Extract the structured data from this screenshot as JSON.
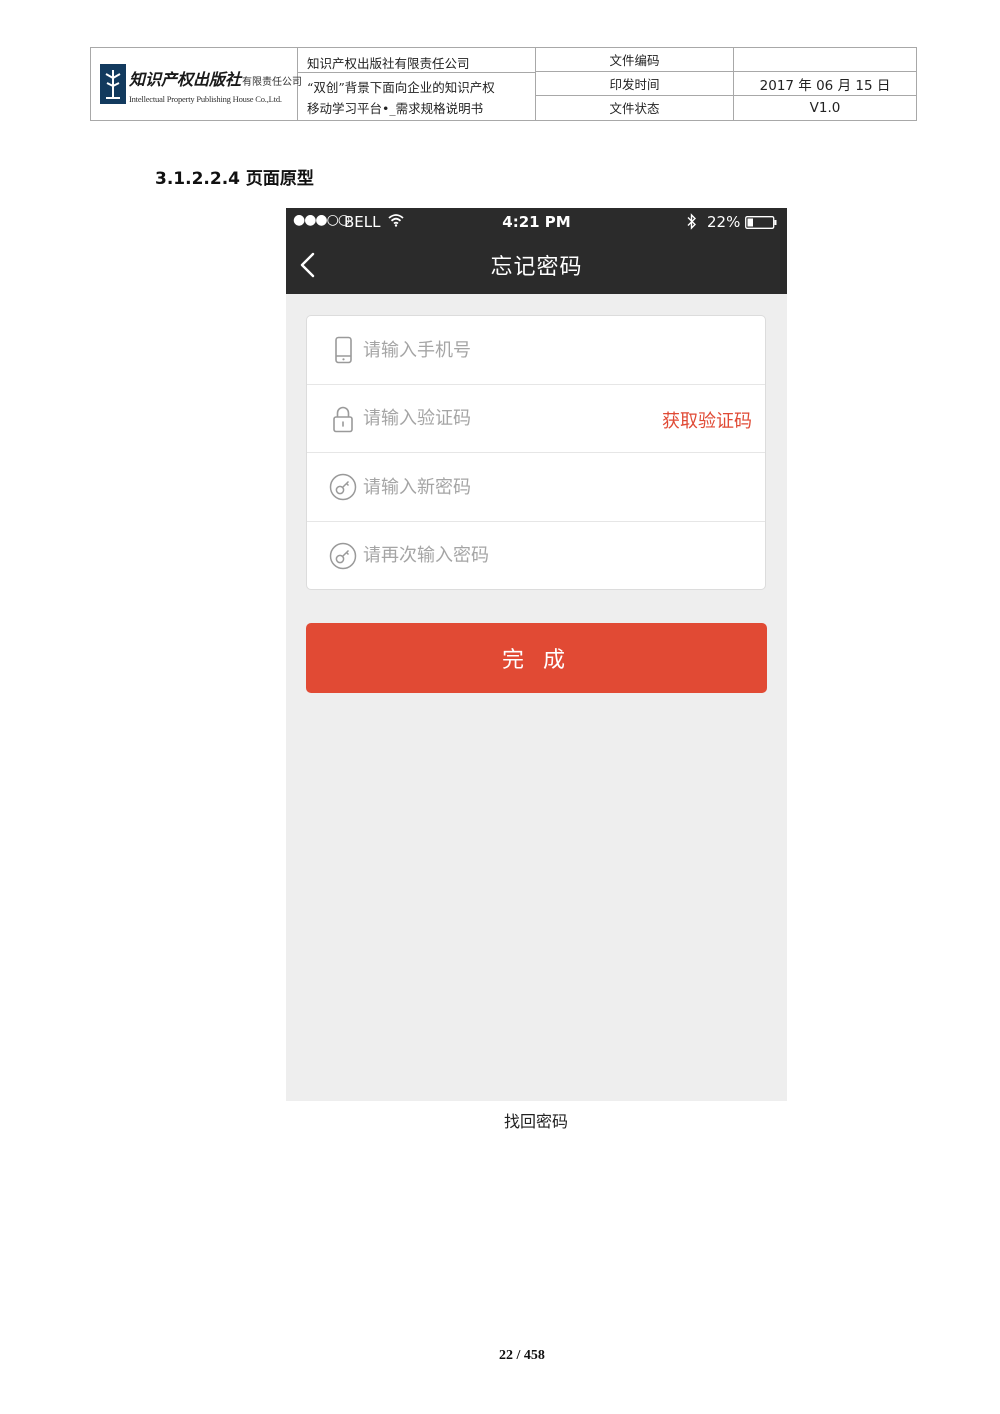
{
  "header": {
    "logo_name": "知识产权出版社",
    "logo_suffix": "有限责任公司",
    "logo_english": "Intellectual Property Publishing House Co.,Ltd.",
    "company": "知识产权出版社有限责任公司",
    "doc_title_line1": "“双创”背景下面向企业的知识产权",
    "doc_title_line2": "移动学习平台•_需求规格说明书",
    "labels": [
      "文件编码",
      "印发时间",
      "文件状态"
    ],
    "values": [
      "",
      "2017 年 06 月 15 日",
      "V1.0"
    ]
  },
  "section_heading": "3.1.2.2.4 页面原型",
  "phone": {
    "status_bar": {
      "signal": "●●●○○",
      "carrier": "BELL",
      "time": "4:21 PM",
      "battery": "22%"
    },
    "nav_title": "忘记密码",
    "fields": {
      "phone_placeholder": "请输入手机号",
      "code_placeholder": "请输入验证码",
      "get_code_label": "获取验证码",
      "new_password_placeholder": "请输入新密码",
      "confirm_password_placeholder": "请再次输入密码"
    },
    "submit_label": "完 成",
    "accent_color": "#e14a34",
    "bar_color": "#2b2b2b",
    "icons": {
      "phone_field": "mobile-phone-icon",
      "code_field": "padlock-icon",
      "password_field": "key-icon",
      "back": "chevron-left-icon"
    }
  },
  "figure_caption": "找回密码",
  "page_number": "22 / 458"
}
